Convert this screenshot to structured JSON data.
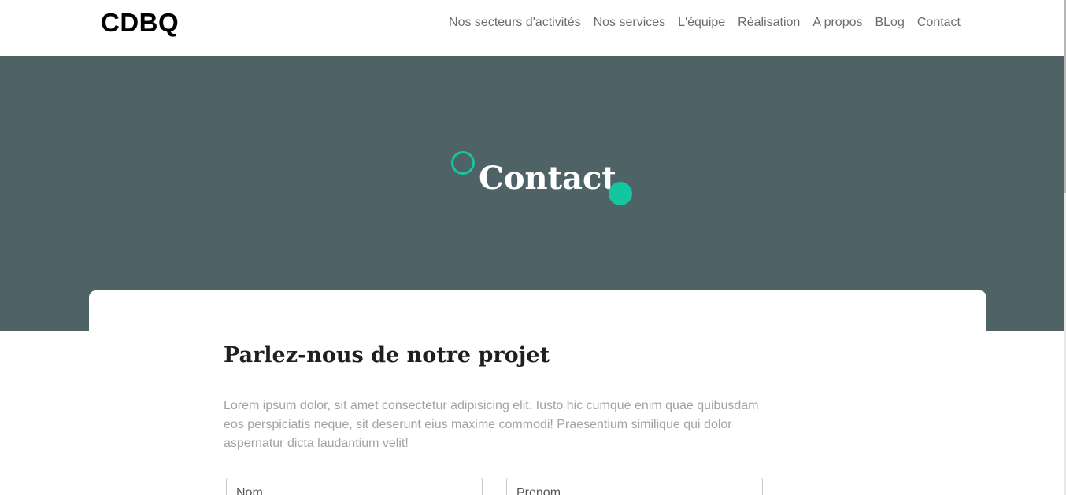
{
  "navbar": {
    "brand": "CDBQ",
    "links": [
      {
        "label": "Nos secteurs d'activités"
      },
      {
        "label": "Nos services"
      },
      {
        "label": "L'équipe"
      },
      {
        "label": "Réalisation"
      },
      {
        "label": "A propos"
      },
      {
        "label": "BLog"
      },
      {
        "label": "Contact"
      }
    ]
  },
  "hero": {
    "title": "Contact"
  },
  "main": {
    "title": "Parlez-nous de notre projet",
    "lead": "Lorem ipsum dolor, sit amet consectetur adipisicing elit. Iusto hic cumque enim quae quibusdam eos perspiciatis neque, sit deserunt eius maxime commodi! Praesentium similique qui dolor aspernatur dicta laudantium velit!",
    "form": {
      "nom_placeholder": "Nom",
      "prenom_placeholder": "Prenom"
    }
  },
  "colors": {
    "hero_bg": "#4f6367",
    "accent": "#14c6a0",
    "nav_text": "#6c6c6c",
    "lead_text": "#a2a2a2"
  },
  "icons": {
    "hero_decor_left": "outlined-circle",
    "hero_decor_right": "filled-circle"
  }
}
